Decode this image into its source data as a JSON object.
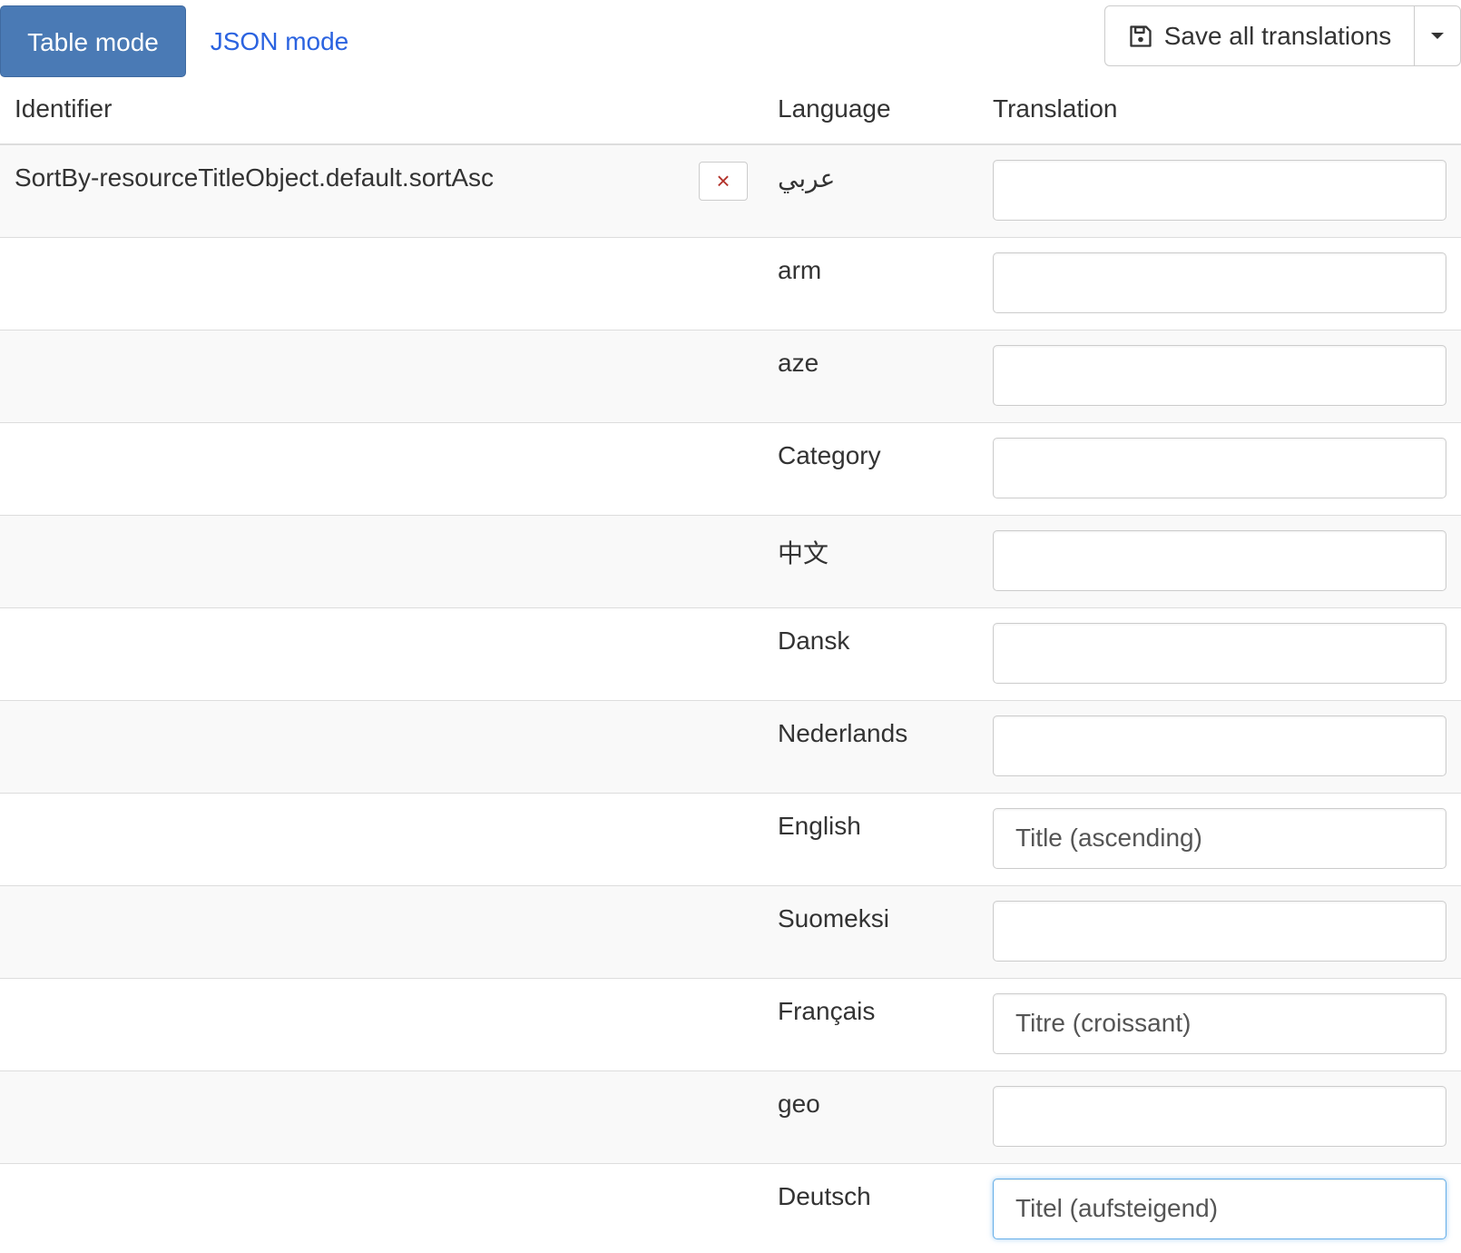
{
  "toolbar": {
    "table_mode_label": "Table mode",
    "json_mode_label": "JSON mode",
    "save_label": "Save all translations",
    "save_icon": "floppy-disk-icon",
    "dropdown_icon": "caret-down-icon"
  },
  "table": {
    "headers": {
      "identifier": "Identifier",
      "language": "Language",
      "translation": "Translation"
    },
    "identifier": "SortBy-resourceTitleObject.default.sortAsc",
    "delete_icon": "×",
    "rows": [
      {
        "language": "عربي",
        "translation": ""
      },
      {
        "language": "arm",
        "translation": ""
      },
      {
        "language": "aze",
        "translation": ""
      },
      {
        "language": "Category",
        "translation": ""
      },
      {
        "language": "中文",
        "translation": ""
      },
      {
        "language": "Dansk",
        "translation": ""
      },
      {
        "language": "Nederlands",
        "translation": ""
      },
      {
        "language": "English",
        "translation": "Title (ascending)"
      },
      {
        "language": "Suomeksi",
        "translation": ""
      },
      {
        "language": "Français",
        "translation": "Titre (croissant)"
      },
      {
        "language": "geo",
        "translation": ""
      },
      {
        "language": "Deutsch",
        "translation": "Titel (aufsteigend)"
      }
    ]
  },
  "colors": {
    "primary": "#4a7ab5",
    "link": "#2b63e0",
    "danger": "#b3332b",
    "focus_ring": "#66afe9"
  }
}
